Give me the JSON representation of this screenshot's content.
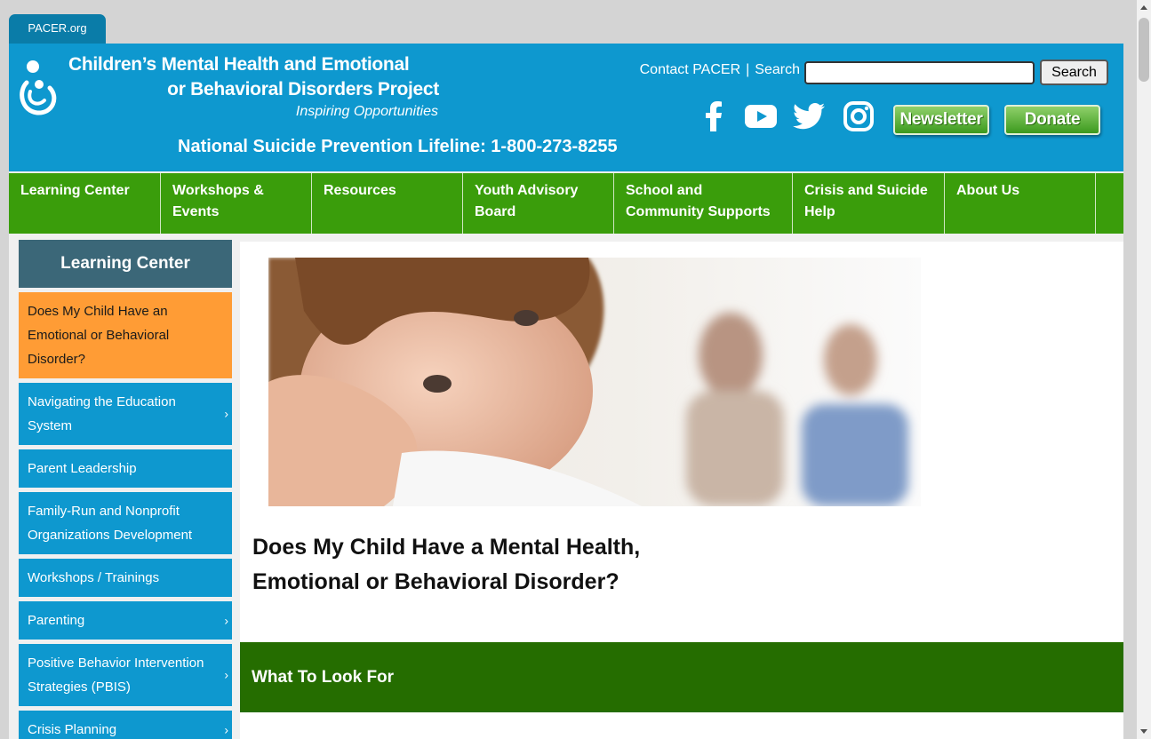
{
  "browser_tab": {
    "label": "PACER.org"
  },
  "header": {
    "title_line1": "Children’s Mental Health and Emotional",
    "title_line2": "or Behavioral Disorders Project",
    "tagline": "Inspiring Opportunities",
    "lifeline": "National Suicide Prevention Lifeline: 1-800-273-8255",
    "contact_link": "Contact PACER",
    "separator": "|",
    "search_label": "Search",
    "search_value": "",
    "search_button": "Search",
    "newsletter_button": "Newsletter",
    "donate_button": "Donate",
    "social_icons": [
      "facebook-icon",
      "youtube-icon",
      "twitter-icon",
      "instagram-icon"
    ]
  },
  "nav": {
    "items": [
      {
        "label": "Learning Center"
      },
      {
        "label": "Workshops & Events"
      },
      {
        "label": "Resources"
      },
      {
        "label": "Youth Advisory Board"
      },
      {
        "label": "School and Community Supports"
      },
      {
        "label": "Crisis and Suicide Help"
      },
      {
        "label": "About Us"
      }
    ]
  },
  "sidebar": {
    "heading": "Learning Center",
    "items": [
      {
        "label": "Does My Child Have an Emotional or Behavioral Disorder?",
        "active": true,
        "chevron": ""
      },
      {
        "label": "Navigating the Education System",
        "chevron": "›"
      },
      {
        "label": "Parent Leadership",
        "chevron": ""
      },
      {
        "label": "Family-Run and Nonprofit Organizations Development",
        "chevron": ""
      },
      {
        "label": "Workshops / Trainings",
        "chevron": ""
      },
      {
        "label": "Parenting",
        "chevron": "›"
      },
      {
        "label": "Positive Behavior Intervention Strategies (PBIS)",
        "chevron": "›"
      },
      {
        "label": "Crisis Planning",
        "chevron": "›"
      }
    ]
  },
  "main": {
    "title": "Does My Child Have a Mental Health, Emotional or Behavioral Disorder?",
    "section_heading": "What To Look For"
  },
  "colors": {
    "header_blue": "#0e98cf",
    "nav_green": "#3a9d0b",
    "sidebar_head": "#3b6778",
    "active_orange": "#ff9c35",
    "section_green": "#256d00"
  }
}
